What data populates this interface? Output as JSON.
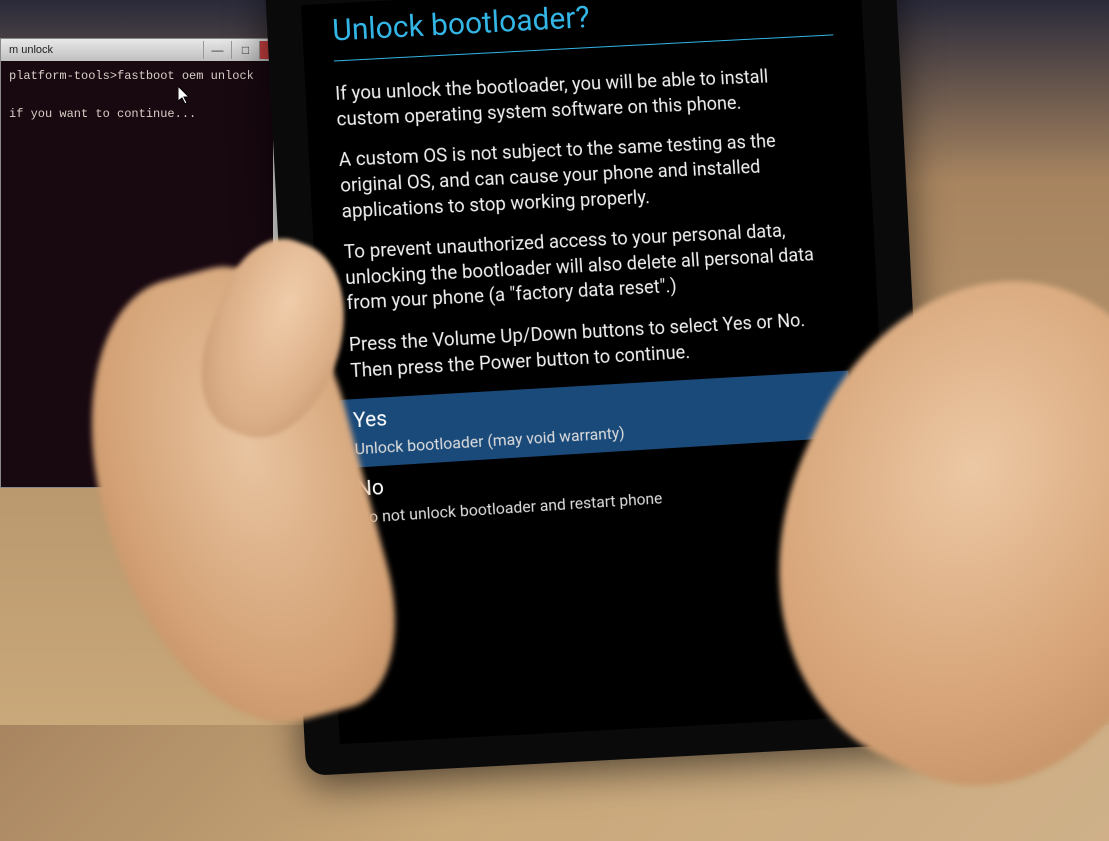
{
  "terminal": {
    "title": "m unlock",
    "line1": "platform-tools>fastboot oem unlock",
    "line2": "if you want to continue..."
  },
  "phone": {
    "title": "Unlock bootloader?",
    "para1": "If you unlock the bootloader, you will be able to install custom operating system software on this phone.",
    "para2": "A custom OS is not subject to the same testing as the original OS, and can cause your phone and installed applications to stop working properly.",
    "para3": "To prevent unauthorized access to your personal data, unlocking the bootloader will also delete all personal data from your phone (a \"factory data reset\".)",
    "para4": "Press the Volume Up/Down buttons to select Yes or No. Then press the Power button to continue.",
    "options": {
      "yes": {
        "title": "Yes",
        "sub": "Unlock bootloader (may void warranty)"
      },
      "no": {
        "title": "No",
        "sub": "Do not unlock bootloader and restart phone"
      }
    }
  },
  "window_controls": {
    "minimize": "—",
    "maximize": "□",
    "close": "×"
  }
}
